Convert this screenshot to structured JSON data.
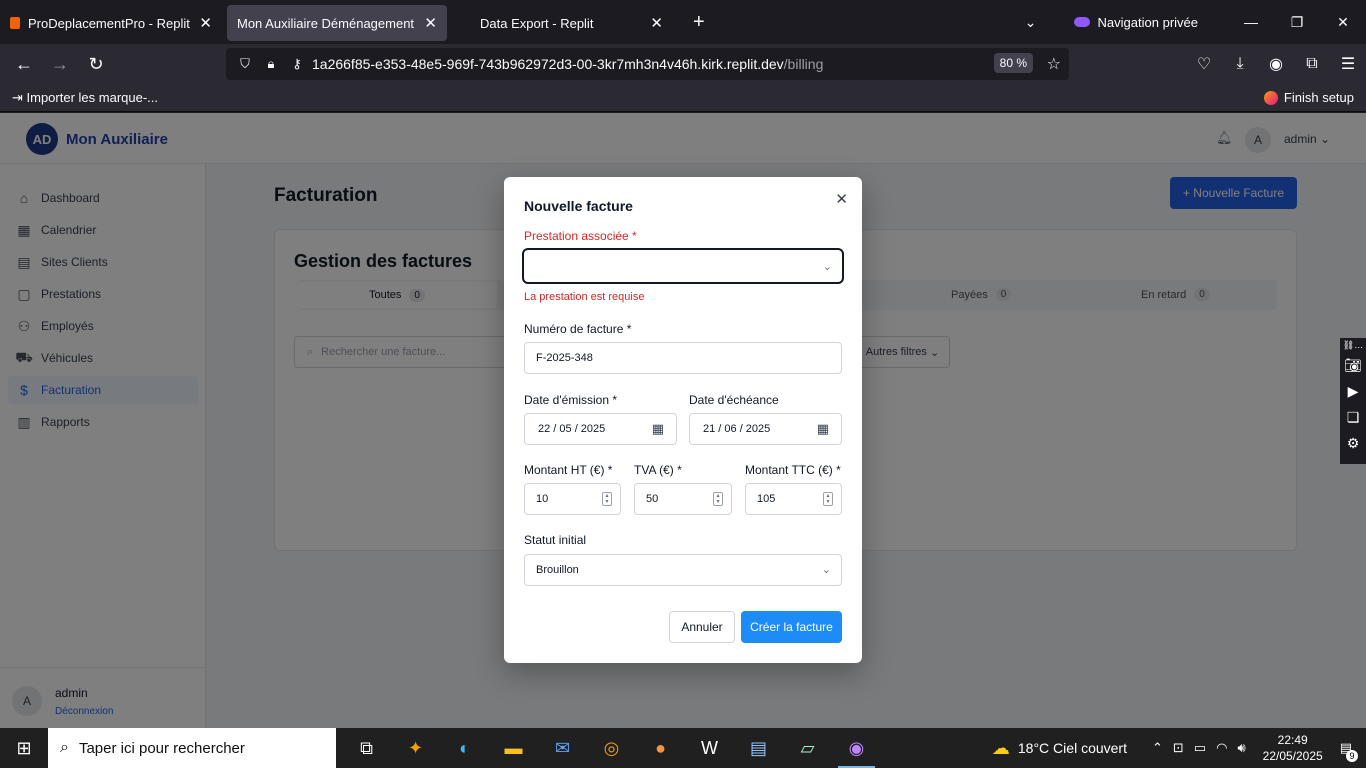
{
  "browser": {
    "tabs": [
      {
        "title": "ProDeplacementPro - Replit",
        "active": false
      },
      {
        "title": "Mon Auxiliaire Déménagement",
        "active": true
      },
      {
        "title": "Data Export - Replit",
        "active": false
      }
    ],
    "private_label": "Navigation privée",
    "url_main": "1a266f85-e353-48e5-969f-743b962972d3-00-3kr7mh3n4v46h.kirk.replit.dev",
    "url_path": "/billing",
    "zoom": "80 %",
    "bookmark_import": "Importer les marque-...",
    "finish_setup": "Finish setup"
  },
  "app": {
    "logo_initials": "AD",
    "logo_name": "Mon Auxiliaire",
    "header_avatar": "A",
    "header_user": "admin",
    "sidebar": [
      {
        "label": "Dashboard",
        "icon": "home-icon"
      },
      {
        "label": "Calendrier",
        "icon": "calendar-icon"
      },
      {
        "label": "Sites Clients",
        "icon": "building-icon"
      },
      {
        "label": "Prestations",
        "icon": "clipboard-icon"
      },
      {
        "label": "Employés",
        "icon": "users-icon"
      },
      {
        "label": "Véhicules",
        "icon": "truck-icon"
      },
      {
        "label": "Facturation",
        "icon": "dollar-icon",
        "active": true
      },
      {
        "label": "Rapports",
        "icon": "bar-chart-icon"
      }
    ],
    "sidebar_user": {
      "avatar": "A",
      "name": "admin",
      "logout": "Déconnexion"
    },
    "page_title": "Facturation",
    "new_invoice_button": "+  Nouvelle Facture",
    "card_title": "Gestion des factures",
    "tabs": [
      {
        "label": "Toutes",
        "count": "0"
      },
      {
        "label": "Payées",
        "count": "0"
      },
      {
        "label": "En retard",
        "count": "0"
      }
    ],
    "search_placeholder": "Rechercher une facture...",
    "filters_label": "Autres filtres",
    "empty_suffix": "."
  },
  "modal": {
    "title": "Nouvelle facture",
    "prestation_label": "Prestation associée *",
    "prestation_value": "",
    "prestation_error": "La prestation est requise",
    "number_label": "Numéro de facture *",
    "number_value": "F-2025-348",
    "issue_date_label": "Date d'émission *",
    "issue_date_value": "22 / 05 / 2025",
    "due_date_label": "Date d'échéance",
    "due_date_value": "21 / 06 / 2025",
    "ht_label": "Montant HT (€) *",
    "ht_value": "10",
    "tva_label": "TVA (€) *",
    "tva_value": "50",
    "ttc_label": "Montant TTC (€) *",
    "ttc_value": "105",
    "status_label": "Statut initial",
    "status_value": "Brouillon",
    "cancel": "Annuler",
    "create": "Créer la facture"
  },
  "taskbar": {
    "search_placeholder": "Taper ici pour rechercher",
    "weather": "18°C  Ciel couvert",
    "time": "22:49",
    "date": "22/05/2025",
    "notifications": "9"
  },
  "colors": {
    "accent": "#2563eb",
    "error": "#dc2626",
    "create_button": "#1d8cf8"
  }
}
